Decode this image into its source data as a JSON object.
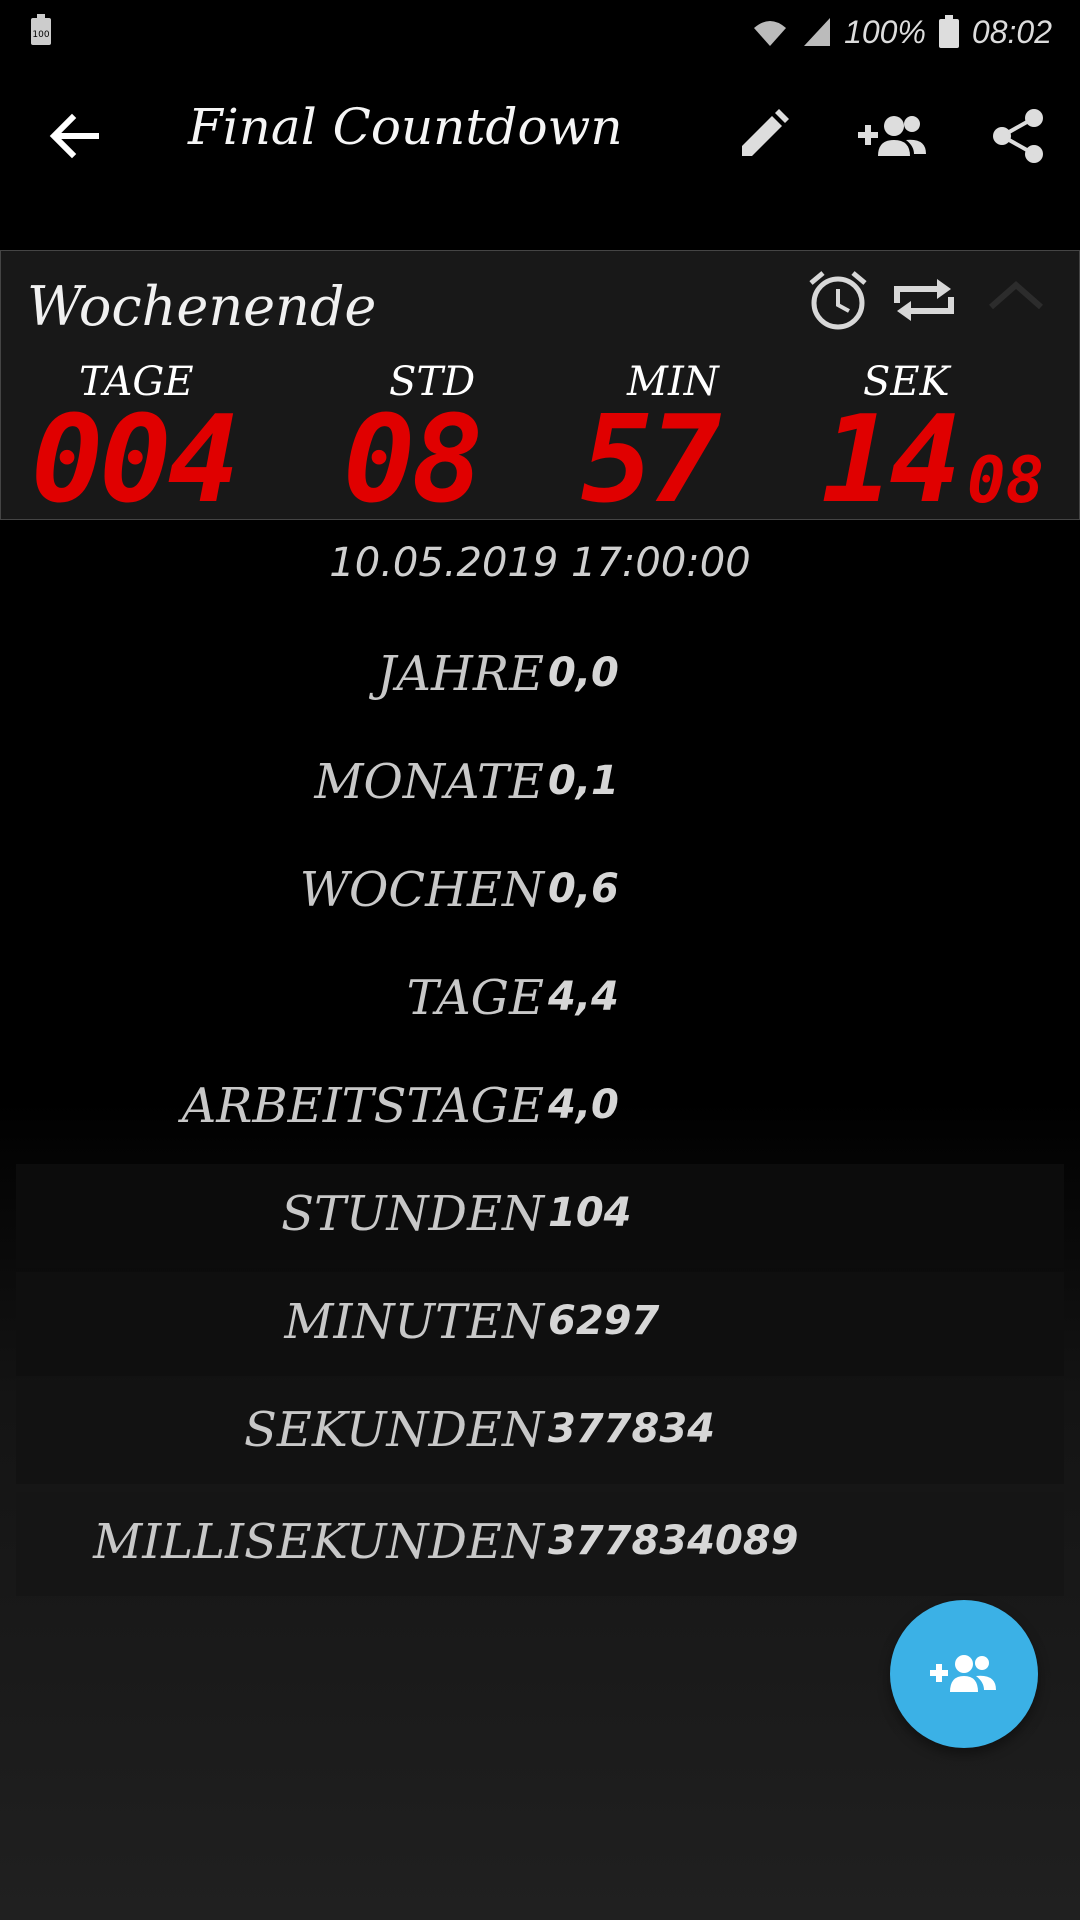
{
  "status_bar": {
    "left_icon": "battery-100-icon",
    "left_badge": "100",
    "battery_percent": "100%",
    "time": "08:02",
    "icons": [
      "wifi-icon",
      "signal-icon",
      "battery-icon"
    ]
  },
  "app_bar": {
    "title": "Final Countdown",
    "actions": [
      "edit-icon",
      "add-group-icon",
      "share-icon"
    ]
  },
  "countdown_card": {
    "name": "Wochenende",
    "icons": [
      "alarm-icon",
      "repeat-icon",
      "chevron-up-icon"
    ],
    "units": {
      "days": {
        "label": "TAGE",
        "value": "004"
      },
      "hours": {
        "label": "STD",
        "value": "08"
      },
      "minutes": {
        "label": "MIN",
        "value": "57"
      },
      "seconds": {
        "label": "SEK",
        "value": "14"
      },
      "centis": {
        "value": "08"
      }
    }
  },
  "target_date": "10.05.2019 17:00:00",
  "stats": [
    {
      "label": "JAHRE",
      "value": "0,0"
    },
    {
      "label": "MONATE",
      "value": "0,1"
    },
    {
      "label": "WOCHEN",
      "value": "0,6"
    },
    {
      "label": "TAGE",
      "value": "4,4"
    },
    {
      "label": "ARBEITSTAGE",
      "value": "4,0"
    },
    {
      "label": "STUNDEN",
      "value": "104"
    },
    {
      "label": "MINUTEN",
      "value": "6297"
    },
    {
      "label": "SEKUNDEN",
      "value": "377834"
    },
    {
      "label": "MILLISEKUNDEN",
      "value": "377834089"
    }
  ],
  "fab": {
    "icon": "add-group-icon"
  },
  "colors": {
    "accent": "#3bb1e6",
    "digit_red": "#e00000"
  }
}
